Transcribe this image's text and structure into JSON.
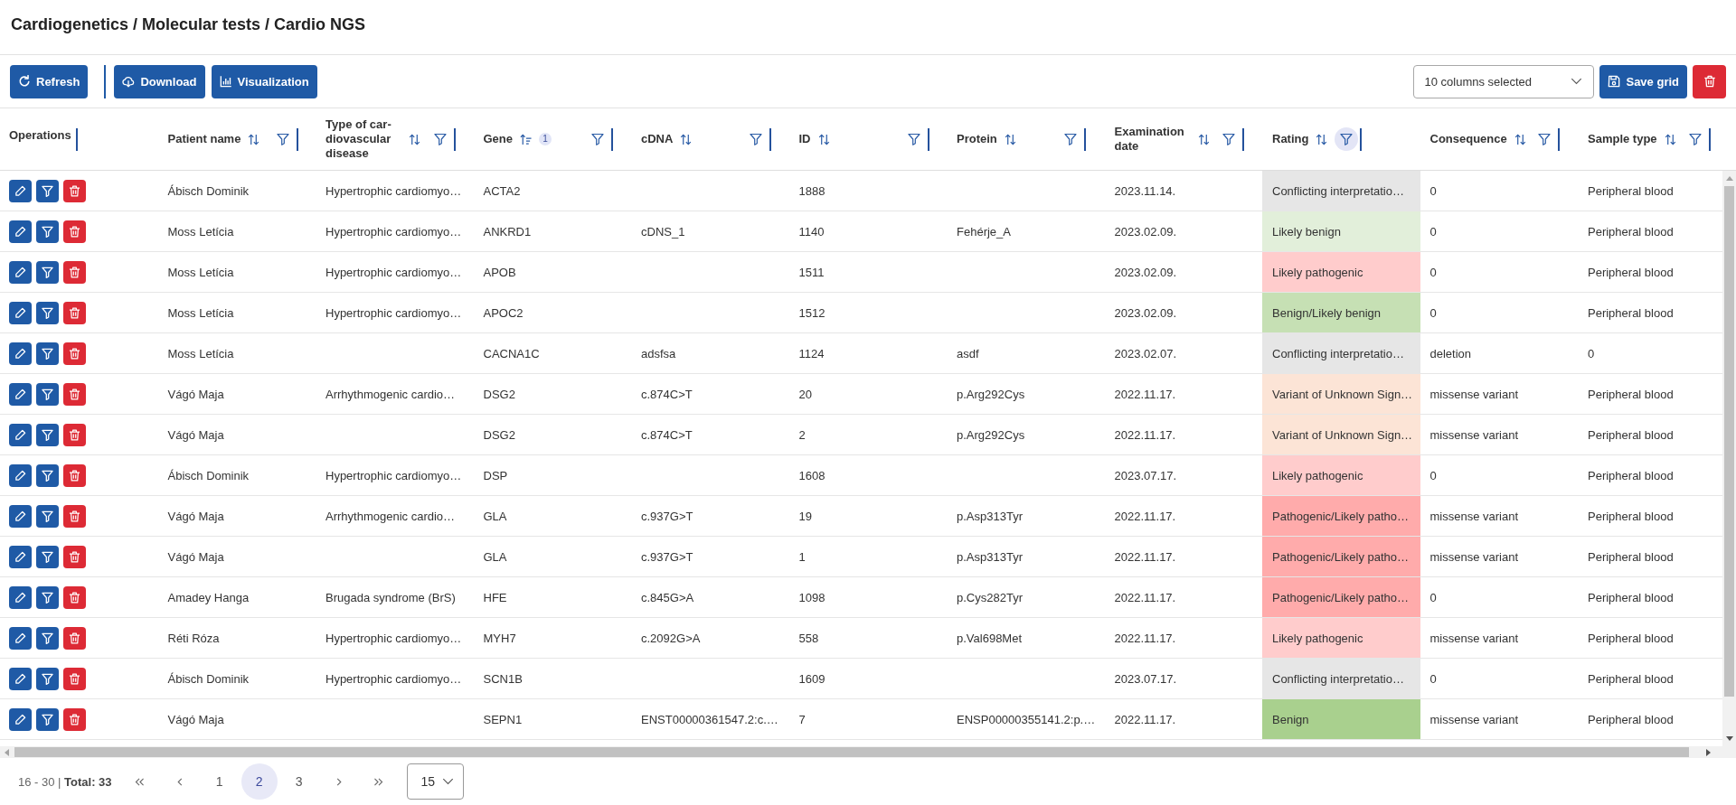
{
  "breadcrumb": "Cardiogenetics / Molecular tests / Cardio NGS",
  "toolbar": {
    "refresh_button": {
      "label": "Refresh"
    },
    "download_button": {
      "label": "Download"
    },
    "visualization_button": {
      "label": "Visualization"
    },
    "column_select": {
      "value": "10 columns selected"
    },
    "save_button": {
      "label": "Save grid"
    }
  },
  "table": {
    "columns": [
      {
        "label": "Operations"
      },
      {
        "label": "Patient name",
        "sorted": false,
        "filter_active": false
      },
      {
        "label": "Type of car-diovascular disease",
        "sorted": false,
        "filter_active": false
      },
      {
        "label": "Gene",
        "sorted": true,
        "sort_order": "1",
        "filter_active": false
      },
      {
        "label": "cDNA",
        "sorted": false,
        "filter_active": false
      },
      {
        "label": "ID",
        "sorted": false,
        "filter_active": false
      },
      {
        "label": "Protein",
        "sorted": false,
        "filter_active": false
      },
      {
        "label": "Examination date",
        "sorted": false,
        "filter_active": false
      },
      {
        "label": "Rating",
        "sorted": false,
        "filter_active": true
      },
      {
        "label": "Consequence",
        "sorted": false,
        "filter_active": false
      },
      {
        "label": "Sample type",
        "sorted": false,
        "filter_active": false
      }
    ],
    "rows": [
      {
        "patient_name": "Ábisch Dominik",
        "cardiovascular_disease": "Hypertrophic cardiomyo…",
        "gene": "ACTA2",
        "id": "1888",
        "examination_date": "2023.11.14.",
        "rating": {
          "text": "Conflicting interpretatio…",
          "color": "#e6e6e6"
        },
        "consequence": "0",
        "sample_type": "Peripheral blood"
      },
      {
        "patient_name": "Moss Letícia",
        "cardiovascular_disease": "Hypertrophic cardiomyo…",
        "gene": "ANKRD1",
        "cdna": "cDNS_1",
        "id": "1140",
        "protein": "Fehérje_A",
        "examination_date": "2023.02.09.",
        "rating": {
          "text": "Likely benign",
          "color": "#e2efda"
        },
        "consequence": "0",
        "sample_type": "Peripheral blood"
      },
      {
        "patient_name": "Moss Letícia",
        "cardiovascular_disease": "Hypertrophic cardiomyo…",
        "gene": "APOB",
        "id": "1511",
        "examination_date": "2023.02.09.",
        "rating": {
          "text": "Likely pathogenic",
          "color": "#ffcccc"
        },
        "consequence": "0",
        "sample_type": "Peripheral blood"
      },
      {
        "patient_name": "Moss Letícia",
        "cardiovascular_disease": "Hypertrophic cardiomyo…",
        "gene": "APOC2",
        "id": "1512",
        "examination_date": "2023.02.09.",
        "rating": {
          "text": "Benign/Likely benign",
          "color": "#c6e0b4"
        },
        "consequence": "0",
        "sample_type": "Peripheral blood"
      },
      {
        "patient_name": "Moss Letícia",
        "gene": "CACNA1C",
        "cdna": "adsfsa",
        "id": "1124",
        "protein": "asdf",
        "examination_date": "2023.02.07.",
        "rating": {
          "text": "Conflicting interpretatio…",
          "color": "#e6e6e6"
        },
        "consequence": "deletion",
        "sample_type": "0"
      },
      {
        "patient_name": "Vágó Maja",
        "cardiovascular_disease": "Arrhythmogenic cardio…",
        "gene": "DSG2",
        "cdna": "c.874C>T",
        "id": "20",
        "protein": "p.Arg292Cys",
        "examination_date": "2022.11.17.",
        "rating": {
          "text": "Variant of Unknown Sign…",
          "color": "#fce4d6"
        },
        "consequence": "missense variant",
        "sample_type": "Peripheral blood"
      },
      {
        "patient_name": "Vágó Maja",
        "gene": "DSG2",
        "cdna": "c.874C>T",
        "id": "2",
        "protein": "p.Arg292Cys",
        "examination_date": "2022.11.17.",
        "rating": {
          "text": "Variant of Unknown Sign…",
          "color": "#fce4d6"
        },
        "consequence": "missense variant",
        "sample_type": "Peripheral blood"
      },
      {
        "patient_name": "Ábisch Dominik",
        "cardiovascular_disease": "Hypertrophic cardiomyo…",
        "gene": "DSP",
        "id": "1608",
        "examination_date": "2023.07.17.",
        "rating": {
          "text": "Likely pathogenic",
          "color": "#ffcccc"
        },
        "consequence": "0",
        "sample_type": "Peripheral blood"
      },
      {
        "patient_name": "Vágó Maja",
        "cardiovascular_disease": "Arrhythmogenic cardio…",
        "gene": "GLA",
        "cdna": "c.937G>T",
        "id": "19",
        "protein": "p.Asp313Tyr",
        "examination_date": "2022.11.17.",
        "rating": {
          "text": "Pathogenic/Likely patho…",
          "color": "#ffabab"
        },
        "consequence": "missense variant",
        "sample_type": "Peripheral blood"
      },
      {
        "patient_name": "Vágó Maja",
        "gene": "GLA",
        "cdna": "c.937G>T",
        "id": "1",
        "protein": "p.Asp313Tyr",
        "examination_date": "2022.11.17.",
        "rating": {
          "text": "Pathogenic/Likely patho…",
          "color": "#ffabab"
        },
        "consequence": "missense variant",
        "sample_type": "Peripheral blood"
      },
      {
        "patient_name": "Amadey Hanga",
        "cardiovascular_disease": "Brugada syndrome (BrS)",
        "gene": "HFE",
        "cdna": "c.845G>A",
        "id": "1098",
        "protein": "p.Cys282Tyr",
        "examination_date": "2022.11.17.",
        "rating": {
          "text": "Pathogenic/Likely patho…",
          "color": "#ffabab"
        },
        "consequence": "0",
        "sample_type": "Peripheral blood"
      },
      {
        "patient_name": "Réti Róza",
        "cardiovascular_disease": "Hypertrophic cardiomyo…",
        "gene": "MYH7",
        "cdna": "c.2092G>A",
        "id": "558",
        "protein": "p.Val698Met",
        "examination_date": "2022.11.17.",
        "rating": {
          "text": "Likely pathogenic",
          "color": "#ffcccc"
        },
        "consequence": "missense variant",
        "sample_type": "Peripheral blood"
      },
      {
        "patient_name": "Ábisch Dominik",
        "cardiovascular_disease": "Hypertrophic cardiomyo…",
        "gene": "SCN1B",
        "id": "1609",
        "examination_date": "2023.07.17.",
        "rating": {
          "text": "Conflicting interpretatio…",
          "color": "#e6e6e6"
        },
        "consequence": "0",
        "sample_type": "Peripheral blood"
      },
      {
        "patient_name": "Vágó Maja",
        "gene": "SEPN1",
        "cdna": "ENST00000361547.2:c.…",
        "id": "7",
        "protein": "ENSP00000355141.2:p.…",
        "examination_date": "2022.11.17.",
        "rating": {
          "text": "Benign",
          "color": "#a9d08e"
        },
        "consequence": "missense variant",
        "sample_type": "Peripheral blood"
      }
    ]
  },
  "pagination": {
    "range": "16 - 30 | **Total: 33**",
    "pages": [
      {
        "label": "1",
        "selected": false
      },
      {
        "label": "2",
        "selected": true
      },
      {
        "label": "3",
        "selected": false
      }
    ],
    "page_size": {
      "value": "15"
    }
  }
}
